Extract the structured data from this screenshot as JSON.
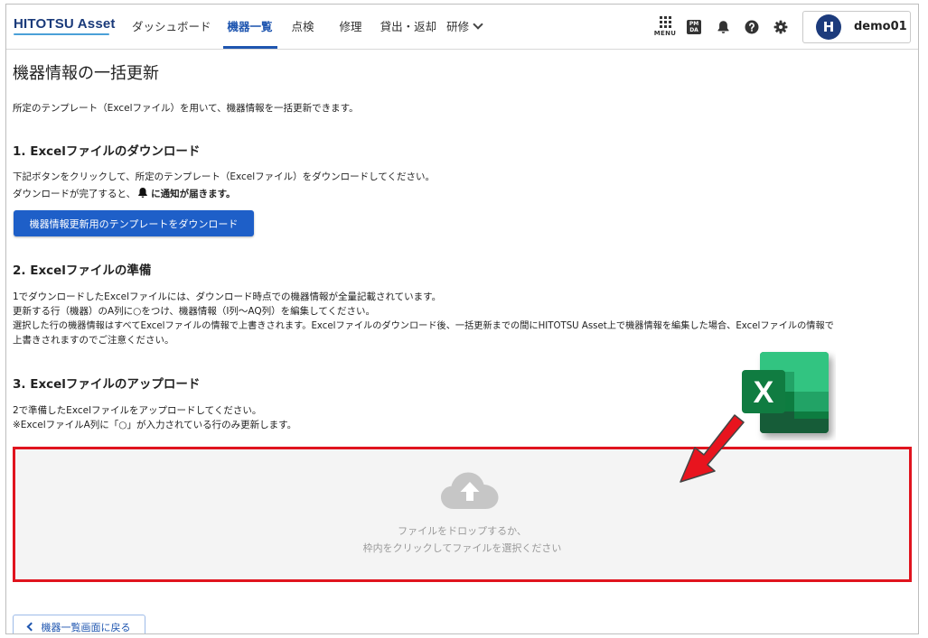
{
  "header": {
    "logo": "HITOTSU Asset",
    "nav": [
      {
        "label": "ダッシュボード"
      },
      {
        "label": "機器一覧"
      },
      {
        "label": "点検"
      },
      {
        "label": "修理"
      },
      {
        "label": "貸出・返却"
      },
      {
        "label": "研修"
      }
    ],
    "menu_label": "MENU",
    "pm_label_top": "PM",
    "pm_label_bottom": "DA",
    "avatar_initial": "H",
    "user_name": "demo01"
  },
  "page": {
    "title": "機器情報の一括更新",
    "intro": "所定のテンプレート（Excelファイル）を用いて、機器情報を一括更新できます。",
    "section1": {
      "heading": "1. Excelファイルのダウンロード",
      "line1": "下記ボタンをクリックして、所定のテンプレート（Excelファイル）をダウンロードしてください。",
      "line2_prefix": "ダウンロードが完了すると、",
      "line2_suffix": "に通知が届きます。",
      "button": "機器情報更新用のテンプレートをダウンロード"
    },
    "section2": {
      "heading": "2. Excelファイルの準備",
      "line1": "1でダウンロードしたExcelファイルには、ダウンロード時点での機器情報が全量記載されています。",
      "line2": "更新する行（機器）のA列に○をつけ、機器情報（I列〜AQ列）を編集してください。",
      "line3": "選択した行の機器情報はすべてExcelファイルの情報で上書きされます。Excelファイルのダウンロード後、一括更新までの間にHITOTSU Asset上で機器情報を編集した場合、Excelファイルの情報で",
      "line4": "上書きされますのでご注意ください。"
    },
    "section3": {
      "heading": "3. Excelファイルのアップロード",
      "line1": "2で準備したExcelファイルをアップロードしてください。",
      "line2": "※ExcelファイルA列に「○」が入力されている行のみ更新します。"
    },
    "dropzone": {
      "line1": "ファイルをドロップするか、",
      "line2": "枠内をクリックしてファイルを選択ください"
    },
    "back_button": "機器一覧画面に戻る",
    "excel_letter": "X"
  },
  "colors": {
    "accent": "#1f56b0",
    "primary_button": "#1e5fc8",
    "highlight_border": "#e0141e",
    "excel_green": "#1e7145"
  }
}
